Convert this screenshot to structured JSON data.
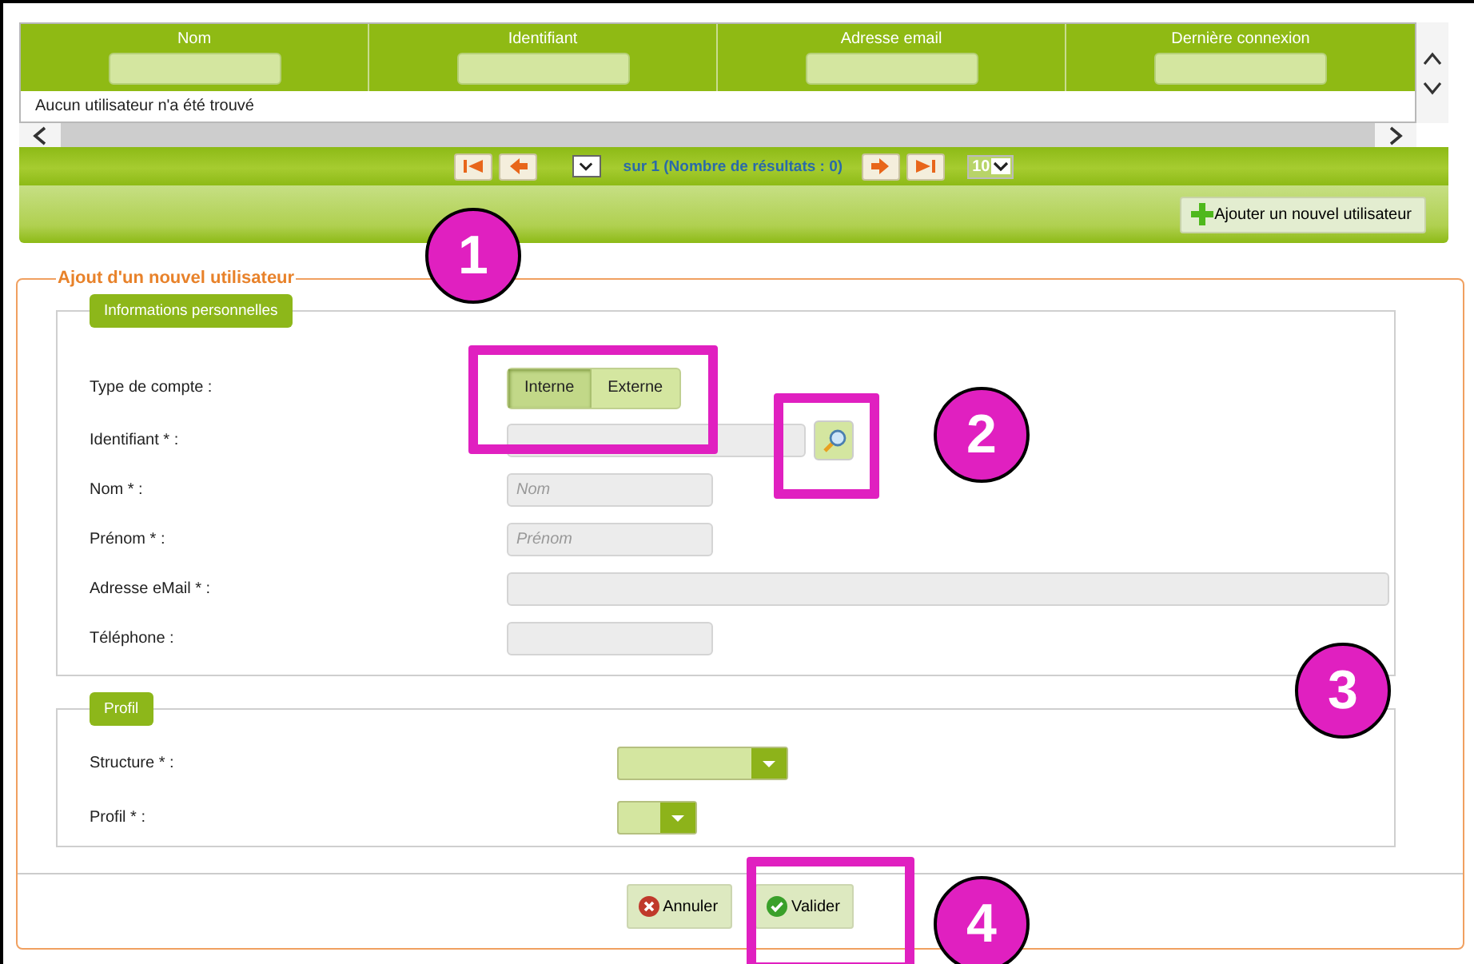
{
  "table": {
    "columns": [
      {
        "title": "Nom"
      },
      {
        "title": "Identifiant"
      },
      {
        "title": "Adresse email"
      },
      {
        "title": "Dernière connexion"
      }
    ],
    "empty_message": "Aucun utilisateur n'a été trouvé"
  },
  "pager": {
    "text": "sur 1 (Nombre de résultats : 0)",
    "page_size": "10"
  },
  "toolbar": {
    "add_button": "Ajouter un nouvel utilisateur"
  },
  "form": {
    "title": "Ajout d'un nouvel utilisateur",
    "personal": {
      "title": "Informations personnelles",
      "account_type": {
        "label": "Type de compte :",
        "options": [
          {
            "label": "Interne",
            "selected": true
          },
          {
            "label": "Externe",
            "selected": false
          }
        ]
      },
      "fields": [
        {
          "kind": "search",
          "label": "Identifiant *  :"
        },
        {
          "kind": "short",
          "label": "Nom *  :",
          "placeholder": "Nom"
        },
        {
          "kind": "short",
          "label": "Prénom *  :",
          "placeholder": "Prénom"
        },
        {
          "kind": "wide",
          "label": "Adresse eMail *  :"
        },
        {
          "kind": "short",
          "label": "Téléphone :"
        }
      ]
    },
    "profile": {
      "title": "Profil",
      "selects": [
        {
          "kind": "wide",
          "label": "Structure *  :"
        },
        {
          "kind": "narrow",
          "label": "Profil *  :"
        }
      ]
    },
    "buttons": [
      {
        "kind": "cancel",
        "label": "Annuler"
      },
      {
        "kind": "confirm",
        "label": "Valider"
      }
    ]
  },
  "callouts": [
    {
      "label": "1"
    },
    {
      "label": "2"
    },
    {
      "label": "3"
    },
    {
      "label": "4"
    }
  ]
}
